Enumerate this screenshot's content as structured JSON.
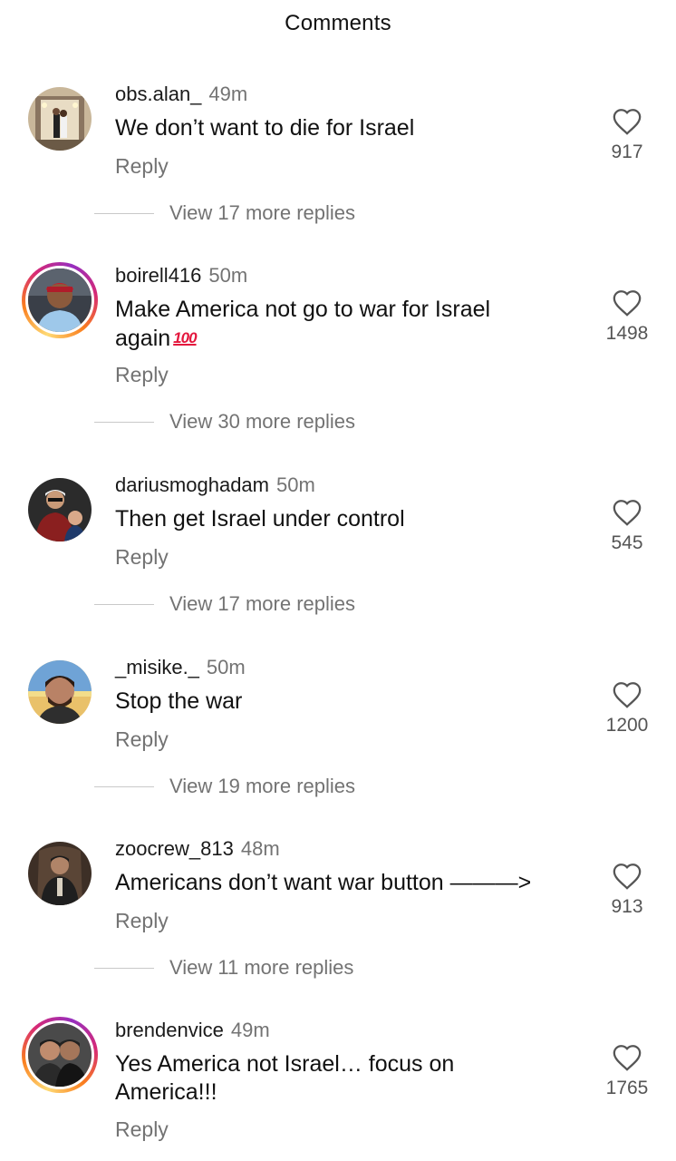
{
  "header": {
    "title": "Comments"
  },
  "comments": [
    {
      "username": "obs.alan_",
      "time": "49m",
      "text": "We don’t want to die for Israel",
      "reply": "Reply",
      "likes": "917",
      "view_more": "View 17 more replies"
    },
    {
      "username": "boirell416",
      "time": "50m",
      "text": "Make America not go to war for Israel again",
      "emoji": "100",
      "reply": "Reply",
      "likes": "1498",
      "view_more": "View 30 more replies"
    },
    {
      "username": "dariusmoghadam",
      "time": "50m",
      "text": "Then get Israel under control",
      "reply": "Reply",
      "likes": "545",
      "view_more": "View 17 more replies"
    },
    {
      "username": "_misike._",
      "time": "50m",
      "text": "Stop the war",
      "reply": "Reply",
      "likes": "1200",
      "view_more": "View 19 more replies"
    },
    {
      "username": "zoocrew_813",
      "time": "48m",
      "text": "Americans don’t want war button ———>",
      "reply": "Reply",
      "likes": "913",
      "view_more": "View 11 more replies"
    },
    {
      "username": "brendenvice",
      "time": "49m",
      "text": "Yes America not Israel… focus on America!!!",
      "reply": "Reply",
      "likes": "1765"
    }
  ],
  "icons": {
    "like": "heart-outline-icon"
  },
  "colors": {
    "story_ring": "#d62976",
    "muted_text": "#737373",
    "emoji_red": "#e4173d"
  }
}
